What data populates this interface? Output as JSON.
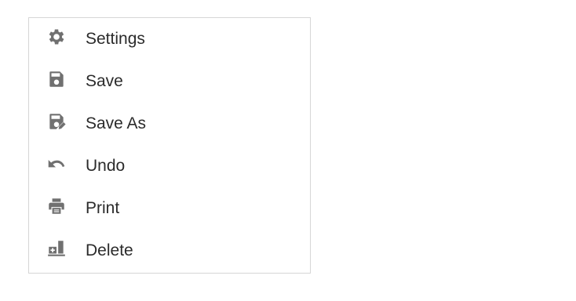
{
  "menu": {
    "items": [
      {
        "label": "Settings",
        "icon": "gear-icon"
      },
      {
        "label": "Save",
        "icon": "floppy-disk-icon"
      },
      {
        "label": "Save As",
        "icon": "floppy-disk-edit-icon"
      },
      {
        "label": "Undo",
        "icon": "undo-arrow-icon"
      },
      {
        "label": "Print",
        "icon": "printer-icon"
      },
      {
        "label": "Delete",
        "icon": "delete-icon"
      }
    ]
  },
  "colors": {
    "icon": "#707070",
    "text": "#2b2b2b",
    "border": "#d6d6d6",
    "background": "#ffffff"
  }
}
